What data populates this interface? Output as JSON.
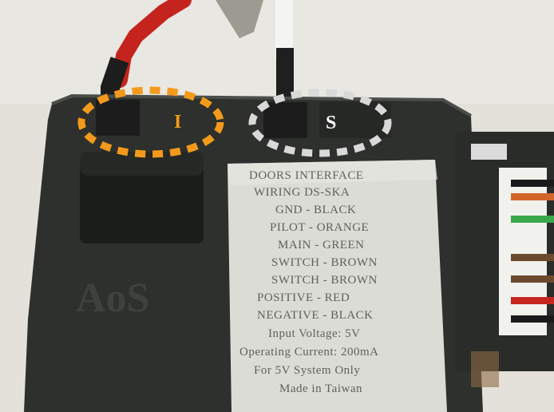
{
  "annotations": {
    "left_marker": "I",
    "right_marker": "S",
    "left_color": "#f39a1c",
    "right_color": "#d9d9d9"
  },
  "sticker": {
    "lines": [
      "DOORS INTERFACE",
      "WIRING DS-SKA",
      "GND - BLACK",
      "PILOT - ORANGE",
      "MAIN - GREEN",
      "SWITCH - BROWN",
      "SWITCH - BROWN",
      "POSITIVE - RED",
      "NEGATIVE - BLACK",
      "Input Voltage: 5V",
      "Operating Current: 200mA",
      "For 5V System Only",
      "Made in Taiwan"
    ]
  },
  "logo_text": "AoS",
  "wire_colors": [
    "#1a1a1a",
    "#d4652a",
    "#3aa84a",
    "#6b4a2d",
    "#6b4a2d",
    "#c7261f",
    "#1a1a1a"
  ]
}
